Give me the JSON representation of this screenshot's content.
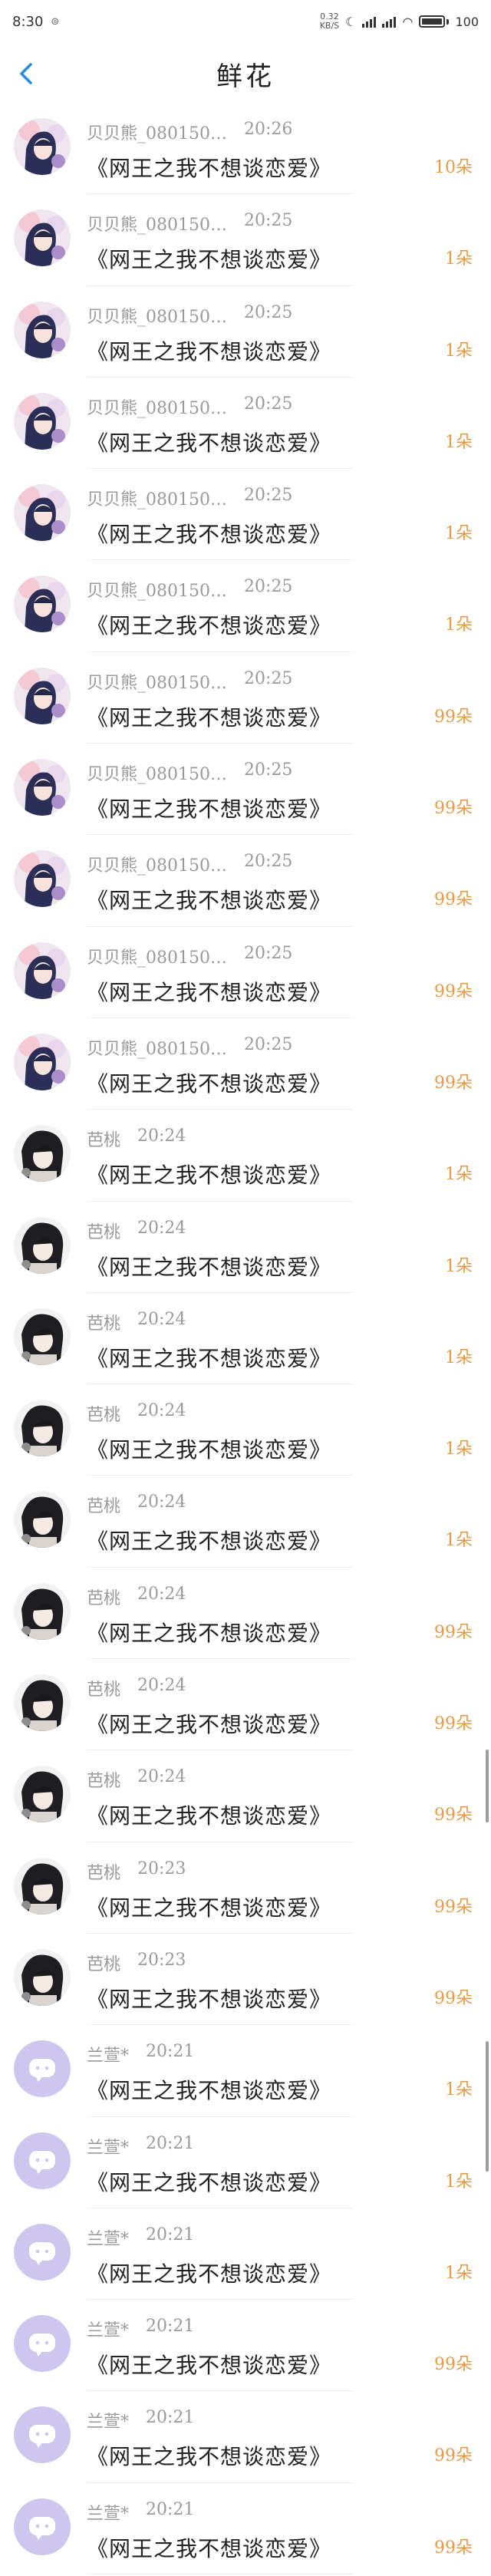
{
  "status": {
    "time": "8:30",
    "net_speed_top": "0.32",
    "net_speed_bottom": "KB/S",
    "battery": "100"
  },
  "header": {
    "title": "鲜花"
  },
  "icons": {
    "back": "chevron-left-icon",
    "mini": "message-icon"
  },
  "rows": [
    {
      "user": "贝贝熊_080150…",
      "time": "20:26",
      "book": "《网王之我不想谈恋爱》",
      "count": "10朵",
      "avatar": "anime"
    },
    {
      "user": "贝贝熊_080150…",
      "time": "20:25",
      "book": "《网王之我不想谈恋爱》",
      "count": "1朵",
      "avatar": "anime"
    },
    {
      "user": "贝贝熊_080150…",
      "time": "20:25",
      "book": "《网王之我不想谈恋爱》",
      "count": "1朵",
      "avatar": "anime"
    },
    {
      "user": "贝贝熊_080150…",
      "time": "20:25",
      "book": "《网王之我不想谈恋爱》",
      "count": "1朵",
      "avatar": "anime"
    },
    {
      "user": "贝贝熊_080150…",
      "time": "20:25",
      "book": "《网王之我不想谈恋爱》",
      "count": "1朵",
      "avatar": "anime"
    },
    {
      "user": "贝贝熊_080150…",
      "time": "20:25",
      "book": "《网王之我不想谈恋爱》",
      "count": "1朵",
      "avatar": "anime"
    },
    {
      "user": "贝贝熊_080150…",
      "time": "20:25",
      "book": "《网王之我不想谈恋爱》",
      "count": "99朵",
      "avatar": "anime"
    },
    {
      "user": "贝贝熊_080150…",
      "time": "20:25",
      "book": "《网王之我不想谈恋爱》",
      "count": "99朵",
      "avatar": "anime"
    },
    {
      "user": "贝贝熊_080150…",
      "time": "20:25",
      "book": "《网王之我不想谈恋爱》",
      "count": "99朵",
      "avatar": "anime"
    },
    {
      "user": "贝贝熊_080150…",
      "time": "20:25",
      "book": "《网王之我不想谈恋爱》",
      "count": "99朵",
      "avatar": "anime"
    },
    {
      "user": "贝贝熊_080150…",
      "time": "20:25",
      "book": "《网王之我不想谈恋爱》",
      "count": "99朵",
      "avatar": "anime"
    },
    {
      "user": "芭桃",
      "time": "20:24",
      "book": "《网王之我不想谈恋爱》",
      "count": "1朵",
      "avatar": "dark"
    },
    {
      "user": "芭桃",
      "time": "20:24",
      "book": "《网王之我不想谈恋爱》",
      "count": "1朵",
      "avatar": "dark"
    },
    {
      "user": "芭桃",
      "time": "20:24",
      "book": "《网王之我不想谈恋爱》",
      "count": "1朵",
      "avatar": "dark"
    },
    {
      "user": "芭桃",
      "time": "20:24",
      "book": "《网王之我不想谈恋爱》",
      "count": "1朵",
      "avatar": "dark"
    },
    {
      "user": "芭桃",
      "time": "20:24",
      "book": "《网王之我不想谈恋爱》",
      "count": "1朵",
      "avatar": "dark"
    },
    {
      "user": "芭桃",
      "time": "20:24",
      "book": "《网王之我不想谈恋爱》",
      "count": "99朵",
      "avatar": "dark"
    },
    {
      "user": "芭桃",
      "time": "20:24",
      "book": "《网王之我不想谈恋爱》",
      "count": "99朵",
      "avatar": "dark"
    },
    {
      "user": "芭桃",
      "time": "20:24",
      "book": "《网王之我不想谈恋爱》",
      "count": "99朵",
      "avatar": "dark"
    },
    {
      "user": "芭桃",
      "time": "20:23",
      "book": "《网王之我不想谈恋爱》",
      "count": "99朵",
      "avatar": "dark"
    },
    {
      "user": "芭桃",
      "time": "20:23",
      "book": "《网王之我不想谈恋爱》",
      "count": "99朵",
      "avatar": "dark"
    },
    {
      "user": "兰萱*",
      "time": "20:21",
      "book": "《网王之我不想谈恋爱》",
      "count": "1朵",
      "avatar": "default"
    },
    {
      "user": "兰萱*",
      "time": "20:21",
      "book": "《网王之我不想谈恋爱》",
      "count": "1朵",
      "avatar": "default"
    },
    {
      "user": "兰萱*",
      "time": "20:21",
      "book": "《网王之我不想谈恋爱》",
      "count": "1朵",
      "avatar": "default"
    },
    {
      "user": "兰萱*",
      "time": "20:21",
      "book": "《网王之我不想谈恋爱》",
      "count": "99朵",
      "avatar": "default"
    },
    {
      "user": "兰萱*",
      "time": "20:21",
      "book": "《网王之我不想谈恋爱》",
      "count": "99朵",
      "avatar": "default"
    },
    {
      "user": "兰萱*",
      "time": "20:21",
      "book": "《网王之我不想谈恋爱》",
      "count": "99朵",
      "avatar": "default"
    }
  ]
}
